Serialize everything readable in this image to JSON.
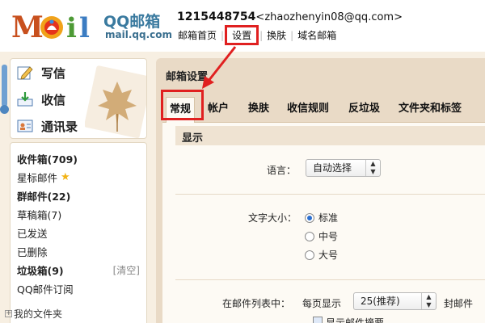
{
  "brand": {
    "title": "QQ邮箱",
    "url": "mail.qq.com",
    "logo_text": "MOil"
  },
  "account": {
    "id": "1215448754",
    "email": "<zhaozhenyin08@qq.com>"
  },
  "topnav": {
    "items": [
      "邮箱首页",
      "设置",
      "换肤",
      "域名邮箱"
    ],
    "highlighted": "设置"
  },
  "sidebar": {
    "compose": "写信",
    "receive": "收信",
    "contacts": "通讯录",
    "folders": [
      {
        "label": "收件箱(709)",
        "bold": true
      },
      {
        "label": "星标邮件",
        "bold": false
      },
      {
        "label": "群邮件(22)",
        "bold": true
      },
      {
        "label": "草稿箱(7)",
        "bold": false
      },
      {
        "label": "已发送",
        "bold": false
      },
      {
        "label": "已删除",
        "bold": false
      },
      {
        "label": "垃圾箱(9)",
        "bold": true
      },
      {
        "label": "QQ邮件订阅",
        "bold": false
      }
    ],
    "clear_label": "[清空]",
    "my_folders": "我的文件夹"
  },
  "main": {
    "title": "邮箱设置",
    "tabs": [
      "常规",
      "帐户",
      "换肤",
      "收信规则",
      "反垃圾",
      "文件夹和标签"
    ],
    "active_tab": "常规",
    "section_title": "显示",
    "language": {
      "label": "语言：",
      "value": "自动选择"
    },
    "font_size": {
      "label": "文字大小：",
      "options": [
        "标准",
        "中号",
        "大号"
      ],
      "selected": "标准"
    },
    "mail_list": {
      "label": "在邮件列表中：",
      "prefix": "每页显示",
      "value": "25(推荐)",
      "suffix": "封邮件"
    },
    "partial_option": "显示邮件摘要"
  },
  "colors": {
    "highlight": "#e02020",
    "brand_blue": "#3a7a9f",
    "panel_bg": "#e9dac6"
  }
}
